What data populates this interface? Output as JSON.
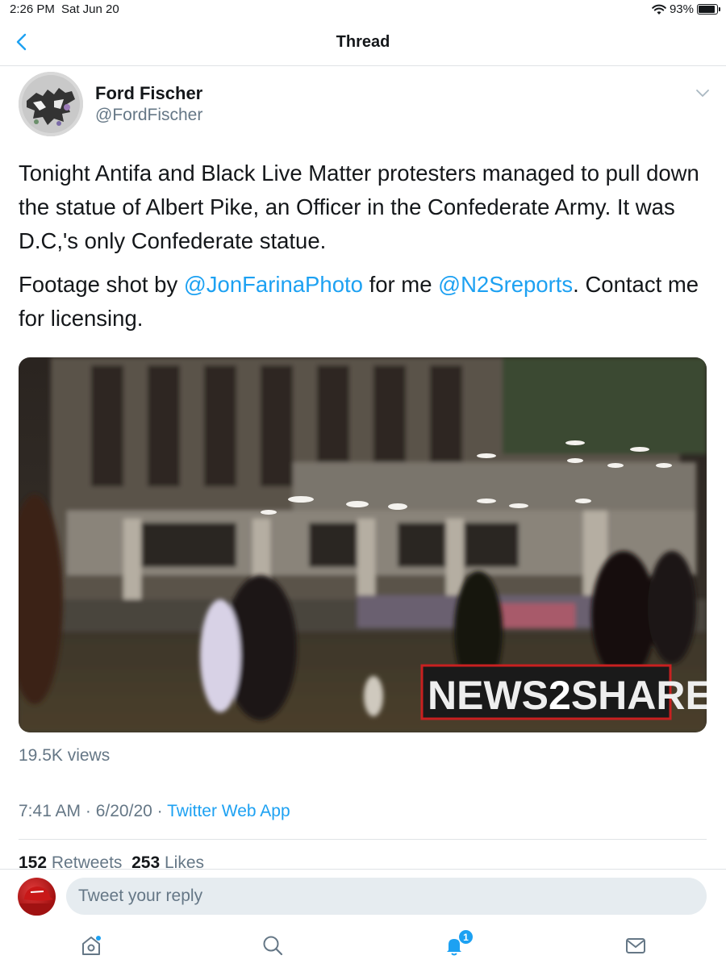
{
  "status_bar": {
    "time": "2:26 PM",
    "date": "Sat Jun 20",
    "battery": "93%",
    "battery_level": 0.93
  },
  "nav": {
    "title": "Thread",
    "back_icon": "chevron-left-icon"
  },
  "tweet": {
    "author_name": "Ford Fischer",
    "author_handle": "@FordFischer",
    "text_paragraph_1": "Tonight Antifa and Black Live Matter protesters managed to pull down the statue of Albert Pike, an Officer in the Confederate Army. It was D.C,'s only Confederate statue.",
    "text_paragraph_2": {
      "prefix": "Footage shot by ",
      "mention_1": "@JonFarinaPhoto",
      "middle": " for me ",
      "mention_2": "@N2Sreports",
      "suffix": ". Contact me for licensing."
    },
    "video_watermark": {
      "part_1": "NEWS",
      "part_2": "2",
      "part_3": "SHARE"
    },
    "views": "19.5K views",
    "time": "7:41 AM",
    "date": "6/20/20",
    "separator": " · ",
    "source": "Twitter Web App",
    "retweets_count": "152",
    "retweets_label": "Retweets",
    "likes_count": "253",
    "likes_label": "Likes"
  },
  "reply": {
    "placeholder": "Tweet your reply"
  },
  "tab_bar": {
    "items": [
      {
        "icon": "home-icon"
      },
      {
        "icon": "search-icon"
      },
      {
        "icon": "notifications-icon",
        "badge": "1"
      },
      {
        "icon": "messages-icon"
      }
    ]
  },
  "colors": {
    "accent": "#1da1f2",
    "text": "#14171a",
    "secondary_text": "#657786",
    "divider": "#dfe3e6"
  }
}
